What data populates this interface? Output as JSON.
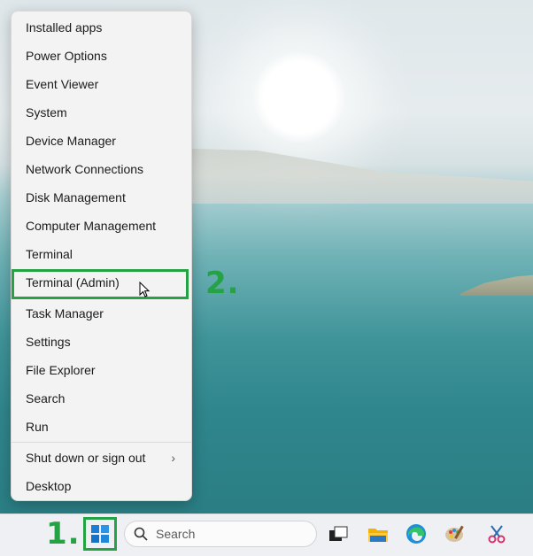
{
  "menu": {
    "items": [
      {
        "label": "Installed apps"
      },
      {
        "label": "Power Options"
      },
      {
        "label": "Event Viewer"
      },
      {
        "label": "System"
      },
      {
        "label": "Device Manager"
      },
      {
        "label": "Network Connections"
      },
      {
        "label": "Disk Management"
      },
      {
        "label": "Computer Management"
      },
      {
        "label": "Terminal"
      },
      {
        "label": "Terminal (Admin)"
      },
      {
        "label": "Task Manager"
      },
      {
        "label": "Settings"
      },
      {
        "label": "File Explorer"
      },
      {
        "label": "Search"
      },
      {
        "label": "Run"
      },
      {
        "label": "Shut down or sign out"
      },
      {
        "label": "Desktop"
      }
    ],
    "submenu_indicator": "›"
  },
  "annotations": {
    "step1": "1.",
    "step2": "2.",
    "color": "#25a244"
  },
  "taskbar": {
    "search_placeholder": "Search",
    "apps": [
      "task-view-icon",
      "file-explorer-icon",
      "edge-icon",
      "paint-icon",
      "snipping-tool-icon"
    ]
  }
}
